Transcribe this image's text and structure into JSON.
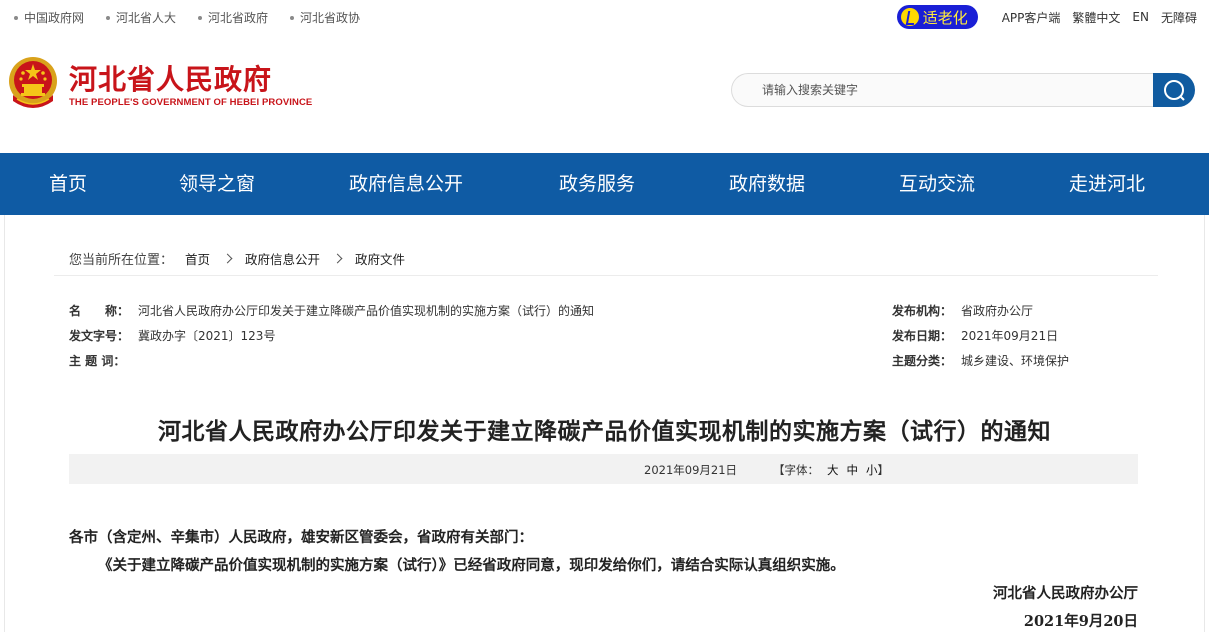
{
  "toplinks": [
    "中国政府网",
    "河北省人大",
    "河北省政府",
    "河北省政协"
  ],
  "topright": {
    "elder": "适老化",
    "app": "APP客户端",
    "traditional": "繁體中文",
    "en": "EN",
    "accessible": "无障碍"
  },
  "header": {
    "title": "河北省人民政府",
    "subtitle": "THE PEOPLE'S GOVERNMENT OF HEBEI PROVINCE"
  },
  "search": {
    "placeholder": "请输入搜索关键字"
  },
  "nav": [
    "首页",
    "领导之窗",
    "政府信息公开",
    "政务服务",
    "政府数据",
    "互动交流",
    "走进河北"
  ],
  "breadcrumb": {
    "label": "您当前所在位置：",
    "items": [
      "首页",
      "政府信息公开",
      "政府文件"
    ]
  },
  "meta": {
    "name_label": "名　　称：",
    "name_value": "河北省人民政府办公厅印发关于建立降碳产品价值实现机制的实施方案（试行）的通知",
    "docno_label": "发文字号：",
    "docno_value": "冀政办字〔2021〕123号",
    "subject_label": "主 题 词：",
    "subject_value": "",
    "org_label": "发布机构：",
    "org_value": "省政府办公厅",
    "date_label": "发布日期：",
    "date_value": "2021年09月21日",
    "category_label": "主题分类：",
    "category_value": "城乡建设、环境保护"
  },
  "doc": {
    "title": "河北省人民政府办公厅印发关于建立降碳产品价值实现机制的实施方案（试行）的通知",
    "date": "2021年09月21日",
    "font_label": "【字体：",
    "font_large": "大",
    "font_medium": "中",
    "font_small": "小",
    "font_close": "】",
    "salutation": "各市（含定州、辛集市）人民政府，雄安新区管委会，省政府有关部门：",
    "paragraph": "《关于建立降碳产品价值实现机制的实施方案（试行）》已经省政府同意，现印发给你们，请结合实际认真组织实施。",
    "signer": "河北省人民政府办公厅",
    "sign_date": "2021年9月20日"
  },
  "colors": {
    "brand_red": "#c8141a",
    "nav_blue": "#0f5ba4",
    "elder_blue": "#1a1fd6"
  }
}
